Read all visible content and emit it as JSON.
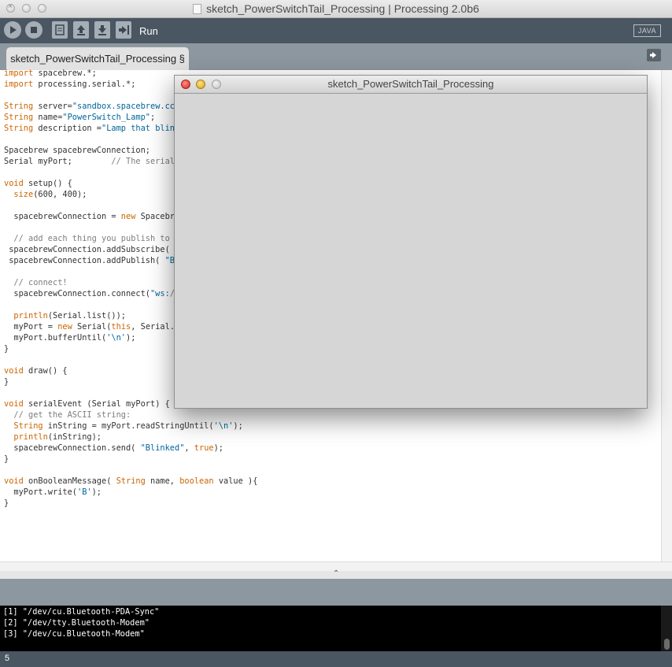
{
  "window": {
    "title": "sketch_PowerSwitchTail_Processing | Processing 2.0b6"
  },
  "toolbar": {
    "run_label": "Run",
    "mode": "JAVA"
  },
  "tabs": [
    {
      "label": "sketch_PowerSwitchTail_Processing §"
    }
  ],
  "code_lines": [
    "import spacebrew.*;",
    "import processing.serial.*;",
    "",
    "String server=\"sandbox.spacebrew.cc\"",
    "String name=\"PowerSwitch_Lamp\";",
    "String description =\"Lamp that blink",
    "",
    "Spacebrew spacebrewConnection;",
    "Serial myPort;        // The serial",
    "",
    "void setup() {",
    "  size(600, 400);",
    "",
    "  spacebrewConnection = new Spacebre",
    "",
    "  // add each thing you publish to",
    " spacebrewConnection.addSubscribe( \"",
    " spacebrewConnection.addPublish( \"Bl",
    "",
    "  // connect!",
    "  spacebrewConnection.connect(\"ws://",
    "",
    "  println(Serial.list());",
    "  myPort = new Serial(this, Serial.l",
    "  myPort.bufferUntil('\\n');",
    "}",
    "",
    "void draw() {",
    "}",
    "",
    "void serialEvent (Serial myPort) {",
    "  // get the ASCII string:",
    "  String inString = myPort.readStringUntil('\\n');",
    "  println(inString);",
    "  spacebrewConnection.send( \"Blinked\", true);",
    "}",
    "",
    "void onBooleanMessage( String name, boolean value ){",
    "  myPort.write('B');",
    "}"
  ],
  "console_lines": [
    "[1] \"/dev/cu.Bluetooth-PDA-Sync\"",
    "[2] \"/dev/tty.Bluetooth-Modem\"",
    "[3] \"/dev/cu.Bluetooth-Modem\""
  ],
  "status": {
    "line_number": "5"
  },
  "sketch_window": {
    "title": "sketch_PowerSwitchTail_Processing",
    "background": "#d6d6d6"
  }
}
